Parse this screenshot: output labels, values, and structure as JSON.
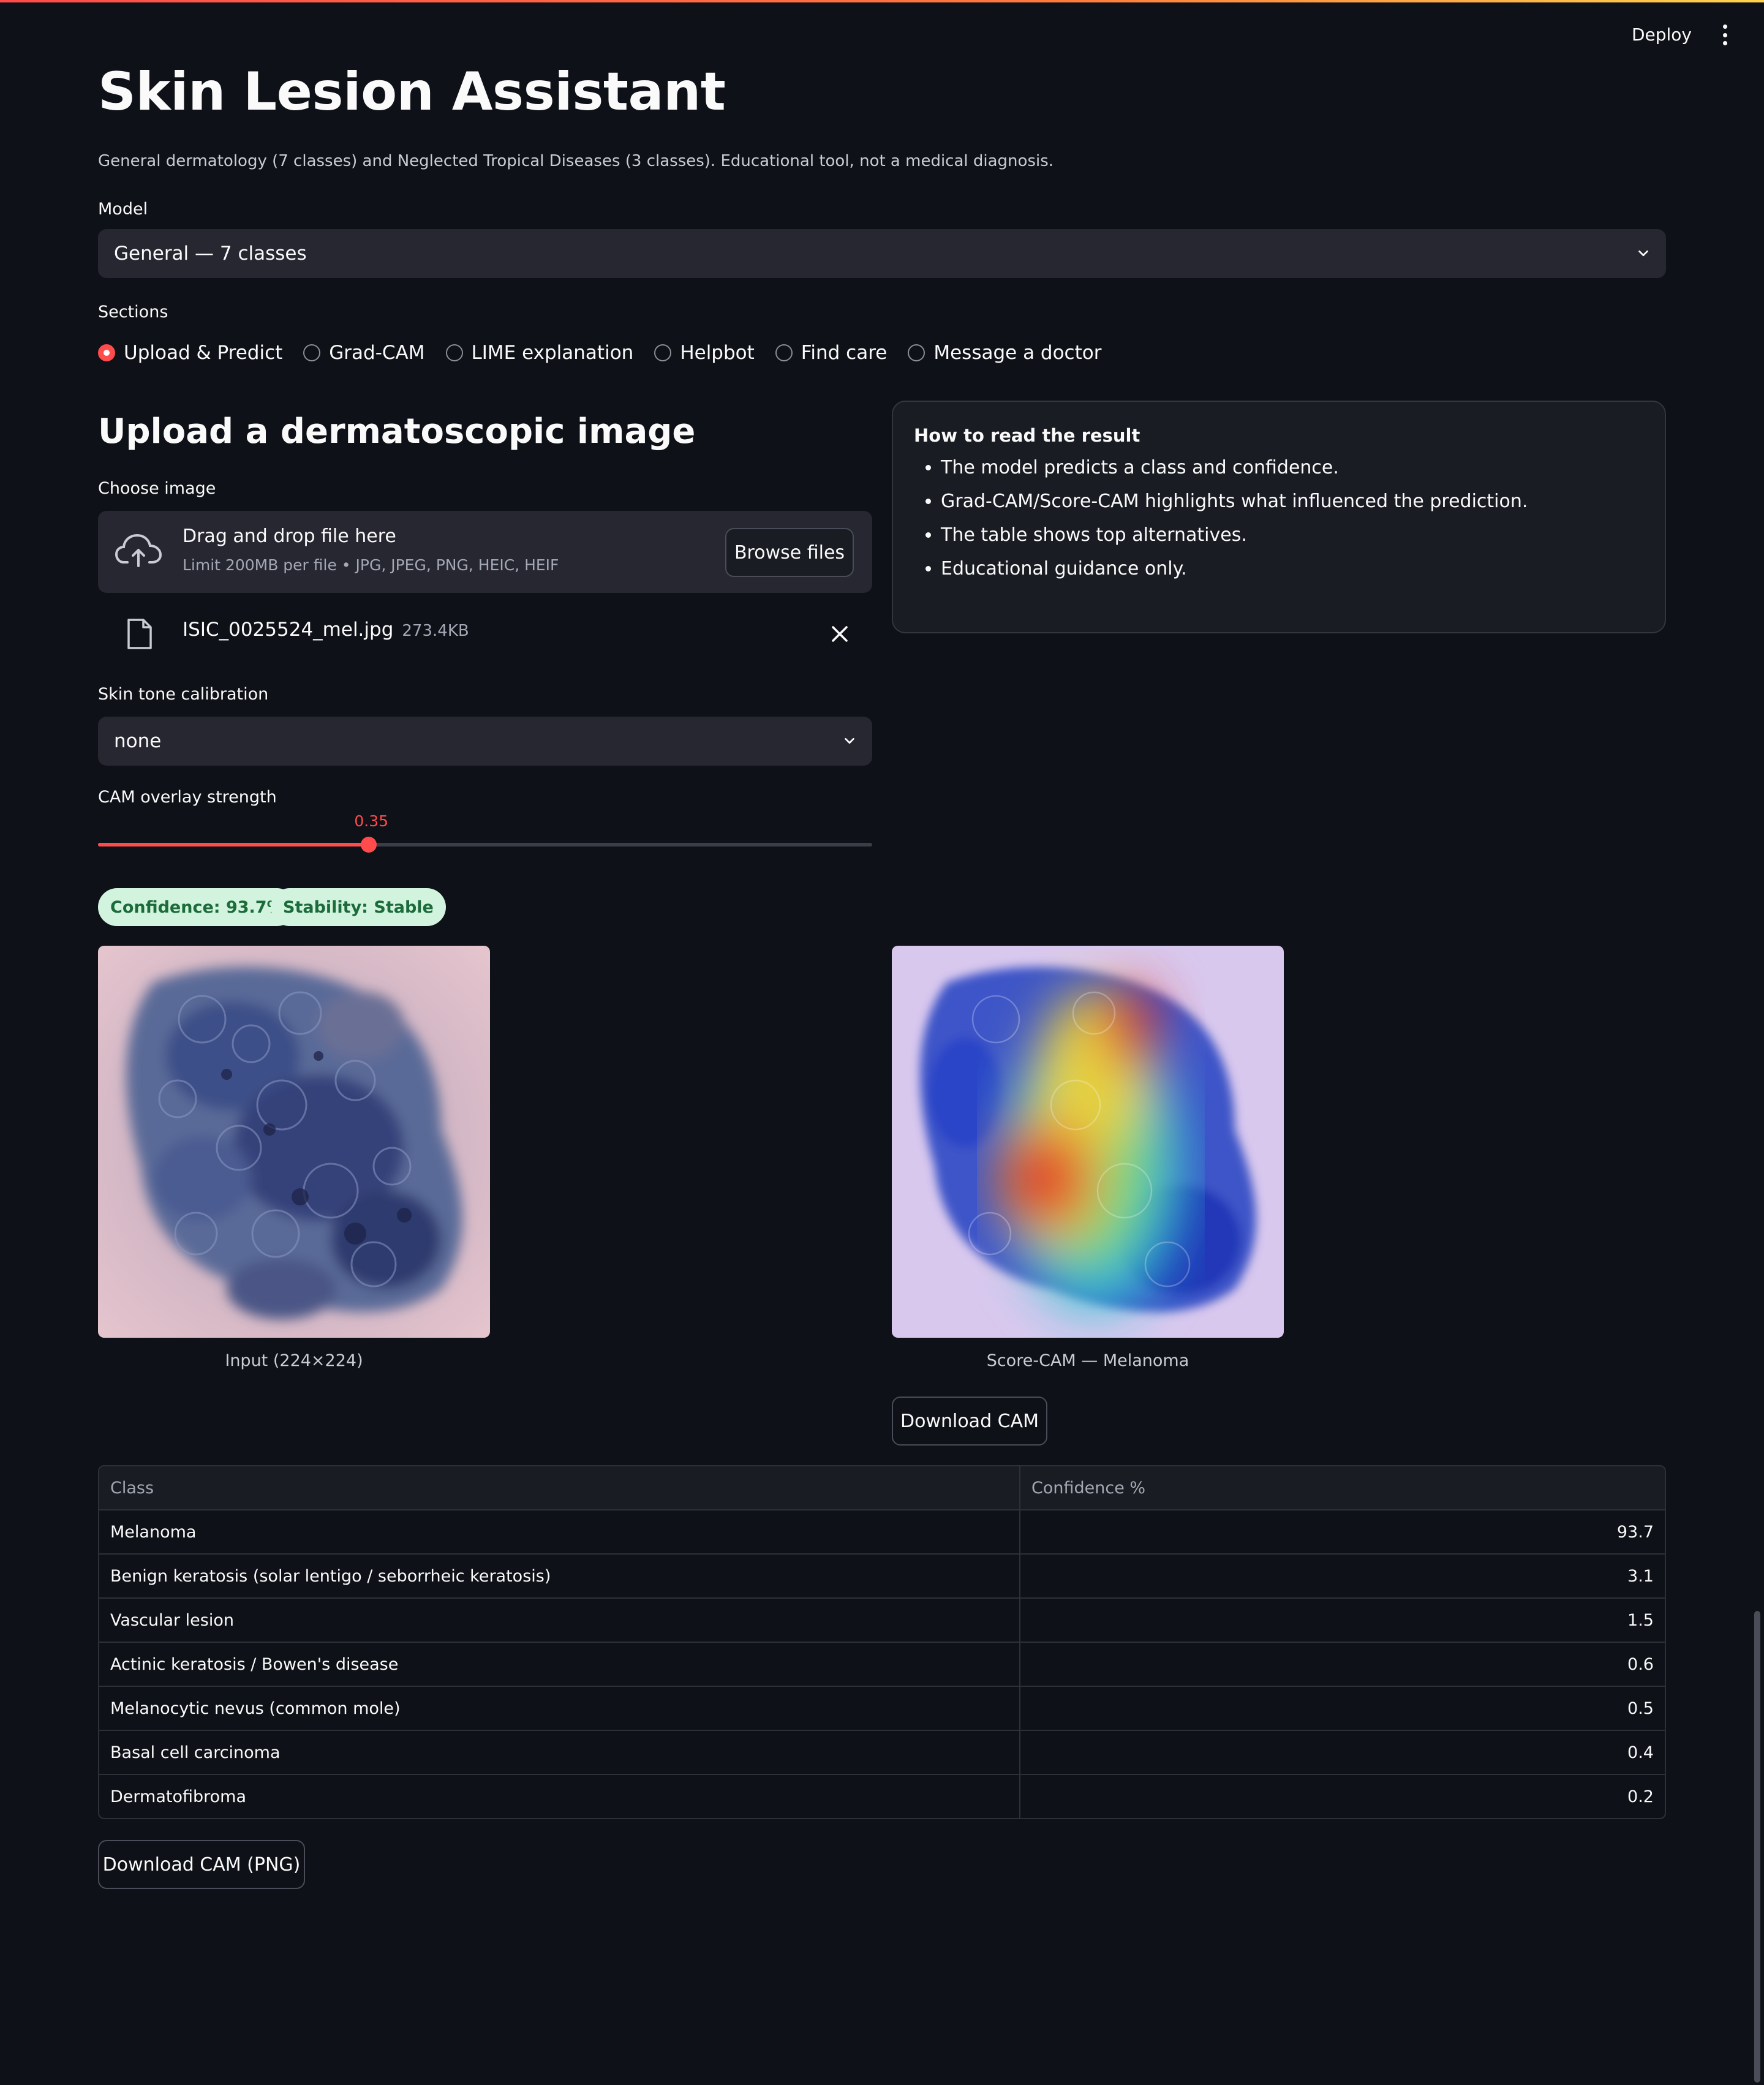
{
  "header": {
    "deploy_label": "Deploy"
  },
  "page": {
    "title": "Skin Lesion Assistant",
    "subtitle": "General dermatology (7 classes) and Neglected Tropical Diseases (3 classes). Educational tool, not a medical diagnosis."
  },
  "model": {
    "label": "Model",
    "selected": "General — 7 classes"
  },
  "sections": {
    "label": "Sections",
    "options": [
      "Upload & Predict",
      "Grad-CAM",
      "LIME explanation",
      "Helpbot",
      "Find care",
      "Message a doctor"
    ],
    "selected": "Upload & Predict"
  },
  "upload": {
    "heading": "Upload a dermatoscopic image",
    "label": "Choose image",
    "drop_title": "Drag and drop file here",
    "drop_limits": "Limit 200MB per file • JPG, JPEG, PNG, HEIC, HEIF",
    "browse_label": "Browse files",
    "file_name": "ISIC_0025524_mel.jpg",
    "file_size": "273.4KB"
  },
  "info": {
    "title": "How to read the result",
    "items": [
      "The model predicts a class and confidence.",
      "Grad-CAM/Score-CAM highlights what influenced the prediction.",
      "The table shows top alternatives.",
      "Educational guidance only."
    ]
  },
  "skin_tone": {
    "label": "Skin tone calibration",
    "selected": "none"
  },
  "cam_strength": {
    "label": "CAM overlay strength",
    "value": "0.35",
    "fraction": 0.35
  },
  "badges": {
    "confidence": "Confidence: 93.7%",
    "stability": "Stability: Stable"
  },
  "images": {
    "input_caption": "Input (224×224)",
    "cam_caption": "Score-CAM — Melanoma",
    "download_cam": "Download CAM"
  },
  "table": {
    "headers": [
      "Class",
      "Confidence %"
    ],
    "rows": [
      {
        "class": "Melanoma",
        "confidence": "93.7"
      },
      {
        "class": "Benign keratosis (solar lentigo / seborrheic keratosis)",
        "confidence": "3.1"
      },
      {
        "class": "Vascular lesion",
        "confidence": "1.5"
      },
      {
        "class": "Actinic keratosis / Bowen's disease",
        "confidence": "0.6"
      },
      {
        "class": "Melanocytic nevus (common mole)",
        "confidence": "0.5"
      },
      {
        "class": "Basal cell carcinoma",
        "confidence": "0.4"
      },
      {
        "class": "Dermatofibroma",
        "confidence": "0.2"
      }
    ]
  },
  "download_png": "Download CAM (PNG)",
  "colors": {
    "accent": "#ff4b4b",
    "background": "#0e1117",
    "badge_bg": "#d2f4de",
    "badge_text": "#1c6b3a"
  }
}
